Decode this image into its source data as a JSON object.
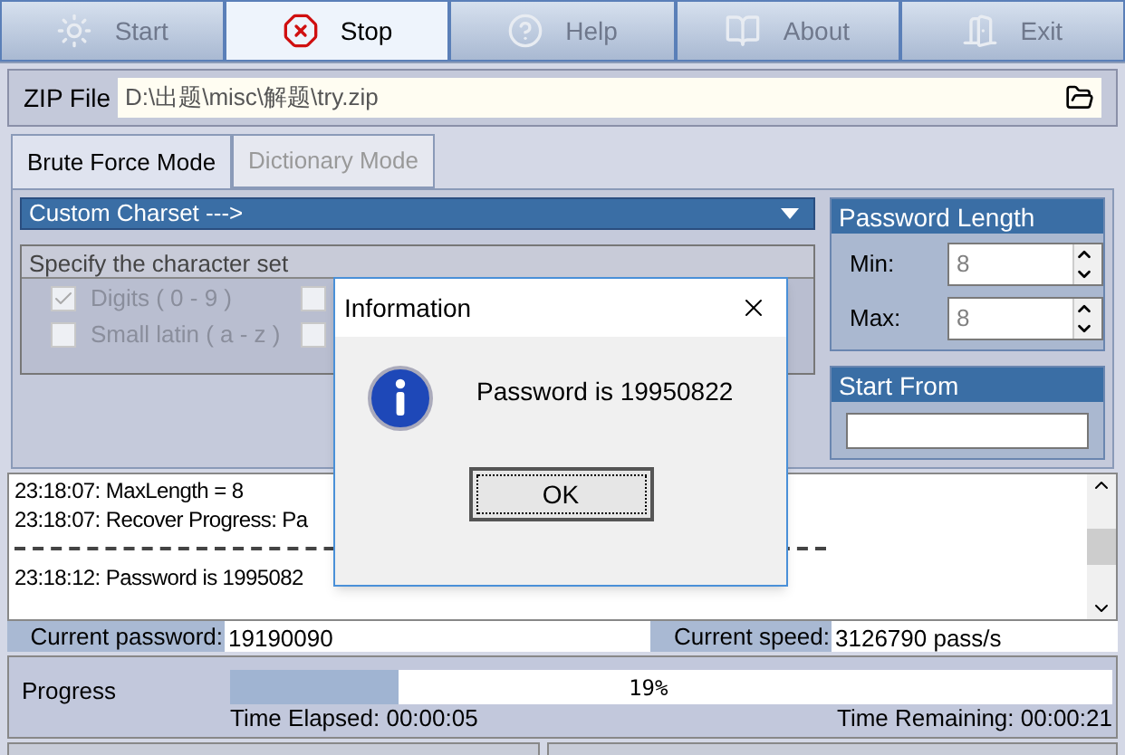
{
  "toolbar": [
    {
      "label": "Start",
      "disabled": true,
      "selected": false
    },
    {
      "label": "Stop",
      "disabled": false,
      "selected": true
    },
    {
      "label": "Help",
      "disabled": true,
      "selected": false
    },
    {
      "label": "About",
      "disabled": true,
      "selected": false
    },
    {
      "label": "Exit",
      "disabled": true,
      "selected": false
    }
  ],
  "zip_file": {
    "label": "ZIP File",
    "value": "D:\\出题\\misc\\解题\\try.zip"
  },
  "tabs": [
    {
      "label": "Brute Force Mode",
      "selected": true
    },
    {
      "label": "Dictionary Mode",
      "selected": false
    }
  ],
  "charset": {
    "value": "Custom Charset  --->",
    "group_title": "Specify the character set",
    "options": [
      {
        "label": "Digits ( 0 - 9 )",
        "checked": true,
        "disabled": true
      },
      {
        "label": "Small latin ( a - z )",
        "checked": false,
        "disabled": true
      },
      {
        "checked": false,
        "disabled": true
      },
      {
        "checked": false,
        "disabled": true
      }
    ]
  },
  "password_length": {
    "title": "Password Length",
    "min_label": "Min:",
    "min": "8",
    "max_label": "Max:",
    "max": "8"
  },
  "start_from": {
    "title": "Start From"
  },
  "log": [
    {
      "kind": "text",
      "text": "23:18:07: MaxLength = 8"
    },
    {
      "kind": "text",
      "text": "23:18:07: Recover Progress: Pa"
    },
    {
      "kind": "separator"
    },
    {
      "kind": "text",
      "text": "23:18:12: Password is 1995082"
    }
  ],
  "current_password": {
    "label": "Current password:",
    "value": "19190090"
  },
  "current_speed": {
    "label": "Current speed:",
    "value": "3126790 pass/s"
  },
  "progress": {
    "label": "Progress",
    "level": 0.19,
    "percent": "19%",
    "elapsed": "Time Elapsed: 00:00:05",
    "remaining": "Time Remaining: 00:00:21"
  },
  "dialog": {
    "title": "Information",
    "message": "Password is 19950822",
    "button": "OK"
  }
}
